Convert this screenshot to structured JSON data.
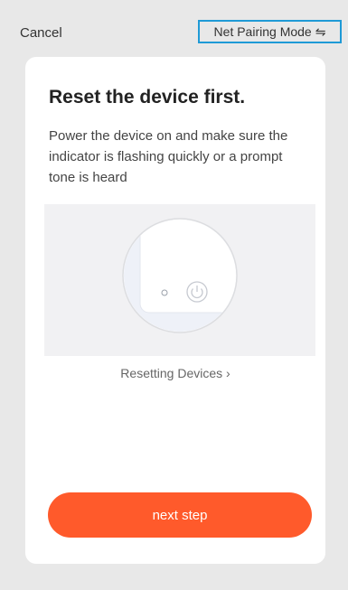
{
  "header": {
    "cancel_label": "Cancel",
    "mode_label": "Net Pairing Mode",
    "mode_icon": "⇋"
  },
  "card": {
    "title": "Reset the device first.",
    "description": "Power the device on and make sure the indicator is flashing quickly or a prompt tone is heard",
    "reset_link": "Resetting Devices ›",
    "next_button": "next step"
  },
  "colors": {
    "accent": "#ff5a2b",
    "highlight_border": "#1f9ad6"
  }
}
